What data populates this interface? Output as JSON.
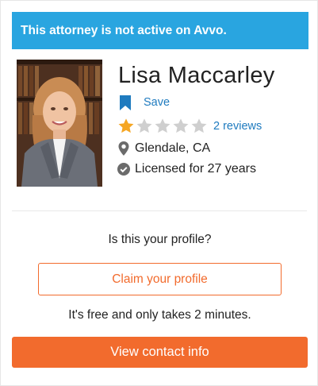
{
  "banner": {
    "text": "This attorney is not active on Avvo."
  },
  "profile": {
    "name": "Lisa Maccarley",
    "save_label": "Save",
    "rating": {
      "stars_filled": 1,
      "stars_total": 5,
      "reviews_label": "2 reviews"
    },
    "location": "Glendale, CA",
    "license": "Licensed for 27 years",
    "photo_alt": "Lisa Maccarley"
  },
  "claim": {
    "question": "Is this your profile?",
    "button_label": "Claim your profile",
    "note": "It's free and only takes 2 minutes."
  },
  "contact": {
    "button_label": "View contact info"
  },
  "colors": {
    "banner_bg": "#29a5e0",
    "accent_orange": "#f26b2d",
    "link_blue": "#1f7bbf",
    "star_filled": "#f5a623",
    "star_empty": "#cfcfcf",
    "icon_gray": "#6b6b6b"
  },
  "icons": [
    "bookmark-icon",
    "star-icon",
    "map-pin-icon",
    "check-circle-icon"
  ]
}
